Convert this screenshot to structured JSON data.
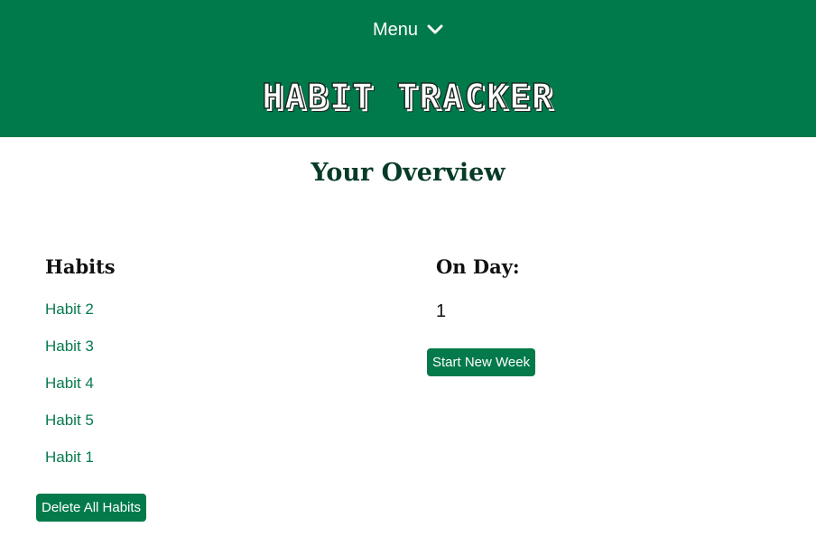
{
  "header": {
    "menu_label": "Menu",
    "menu_icon": "chevron-down-icon",
    "title": "HABIT TRACKER",
    "background_color": "#007a4b"
  },
  "overview": {
    "title": "Your Overview"
  },
  "habits": {
    "heading": "Habits",
    "items": [
      "Habit 2",
      "Habit 3",
      "Habit 4",
      "Habit 5",
      "Habit 1"
    ],
    "delete_button_label": "Delete All Habits"
  },
  "day": {
    "heading": "On Day:",
    "value": "1",
    "new_week_button_label": "Start New Week"
  },
  "colors": {
    "accent": "#047a4b",
    "link": "#067a4c",
    "heading_dark": "#073b27"
  }
}
